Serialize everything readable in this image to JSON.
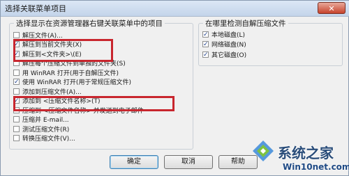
{
  "window": {
    "title": "选择关联菜单项目",
    "close_label": "✕"
  },
  "left_group": {
    "title": "选择显示在资源管理器右键关联菜单中的项目",
    "items": [
      {
        "label": "解压文件(A)...",
        "checked": false
      },
      {
        "label": "解压到当前文件夹(X)",
        "checked": true
      },
      {
        "label": "解压到<文件夹>\\(E)",
        "checked": true
      },
      {
        "label": "解压每个压缩文件到单独的文件夹(S)",
        "checked": false
      },
      {
        "label": "用 WinRAR 打开(用于自解压文件)",
        "checked": false
      },
      {
        "label": "使用 WinRAR 打开(用于常规压缩文件)",
        "checked": true
      },
      {
        "label": "添加到压缩文件(A)...",
        "checked": false
      },
      {
        "label": "添加到 <压缩文件名称>(T)",
        "checked": true
      },
      {
        "label": "压缩到 <压缩文件名称> 并发送到电子邮件",
        "checked": false
      },
      {
        "label": "压缩并 E-mail...",
        "checked": false
      },
      {
        "label": "测试压缩文件(R)",
        "checked": false
      },
      {
        "label": "转换压缩文件(V)...",
        "checked": false
      }
    ]
  },
  "right_group": {
    "title": "在哪里检测自解压缩文件",
    "items": [
      {
        "label": "本地磁盘(L)",
        "checked": true
      },
      {
        "label": "网络磁盘(N)",
        "checked": true
      },
      {
        "label": "其它磁盘(O)",
        "checked": true
      }
    ]
  },
  "buttons": {
    "ok": "确定",
    "cancel": "取消",
    "help": "帮助"
  },
  "watermark": {
    "main": "系统之家",
    "sub": "Win10net.com"
  },
  "colors": {
    "highlight": "#c8262e",
    "check": "#1f3f8a"
  }
}
